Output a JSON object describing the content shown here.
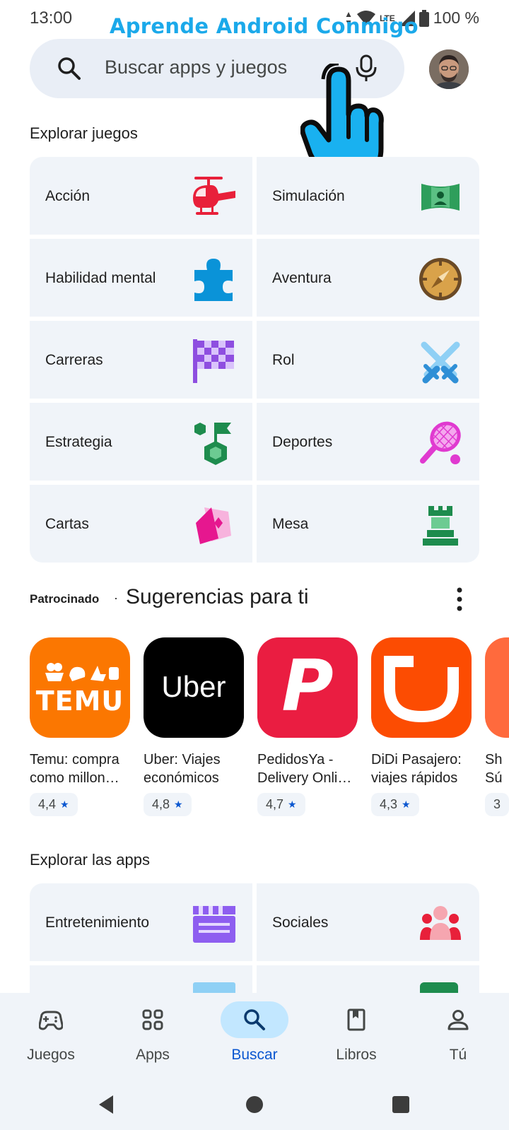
{
  "status_bar": {
    "time": "13:00",
    "network": "LTE",
    "battery": "100 %"
  },
  "watermark": "Aprende Android Conmigo",
  "search": {
    "placeholder": "Buscar apps y juegos"
  },
  "explore_games": {
    "title": "Explorar juegos",
    "categories": [
      {
        "label": "Acción",
        "icon": "helicopter-icon",
        "color": "#e8203a"
      },
      {
        "label": "Simulación",
        "icon": "panorama-icon",
        "color": "#2e9e5b"
      },
      {
        "label": "Habilidad mental",
        "icon": "puzzle-icon",
        "color": "#0a93d8"
      },
      {
        "label": "Aventura",
        "icon": "compass-icon",
        "color": "#d9a24a"
      },
      {
        "label": "Carreras",
        "icon": "checkered-flag-icon",
        "color": "#8e4ee0"
      },
      {
        "label": "Rol",
        "icon": "crossed-swords-icon",
        "color": "#2f8fd6"
      },
      {
        "label": "Estrategia",
        "icon": "strategy-flag-icon",
        "color": "#1e8c4e"
      },
      {
        "label": "Deportes",
        "icon": "tennis-racket-icon",
        "color": "#e03ad0"
      },
      {
        "label": "Cartas",
        "icon": "playing-cards-icon",
        "color": "#e6178f"
      },
      {
        "label": "Mesa",
        "icon": "chess-rook-icon",
        "color": "#1e8c4e"
      }
    ]
  },
  "suggestions": {
    "sponsored": "Patrocinado",
    "title": "Sugerencias para ti",
    "apps": [
      {
        "name_line1": "Temu: compra",
        "name_line2": "como millon…",
        "rating": "4,4",
        "icon_text": "TEMU",
        "color": "#fb7701"
      },
      {
        "name_line1": "Uber: Viajes",
        "name_line2": "económicos",
        "rating": "4,8",
        "icon_text": "Uber",
        "color": "#000000"
      },
      {
        "name_line1": "PedidosYa -",
        "name_line2": "Delivery Onli…",
        "rating": "4,7",
        "icon_text": "P",
        "color": "#ea1d41"
      },
      {
        "name_line1": "DiDi Pasajero:",
        "name_line2": "viajes rápidos",
        "rating": "4,3",
        "icon_text": "",
        "color": "#fc4c02"
      },
      {
        "name_line1": "Sh",
        "name_line2": "Sú",
        "rating": "3",
        "icon_text": "",
        "color": "#ff6a3d"
      }
    ]
  },
  "explore_apps": {
    "title": "Explorar las apps",
    "categories": [
      {
        "label": "Entretenimiento",
        "icon": "clapperboard-icon",
        "color": "#8e5ef0"
      },
      {
        "label": "Sociales",
        "icon": "people-icon",
        "color": "#e8203a"
      }
    ]
  },
  "bottom_nav": {
    "items": [
      {
        "label": "Juegos",
        "icon": "gamepad-icon"
      },
      {
        "label": "Apps",
        "icon": "apps-grid-icon"
      },
      {
        "label": "Buscar",
        "icon": "search-icon"
      },
      {
        "label": "Libros",
        "icon": "book-icon"
      },
      {
        "label": "Tú",
        "icon": "person-icon"
      }
    ],
    "active": "Buscar"
  },
  "accent_color": "#0b57d0"
}
